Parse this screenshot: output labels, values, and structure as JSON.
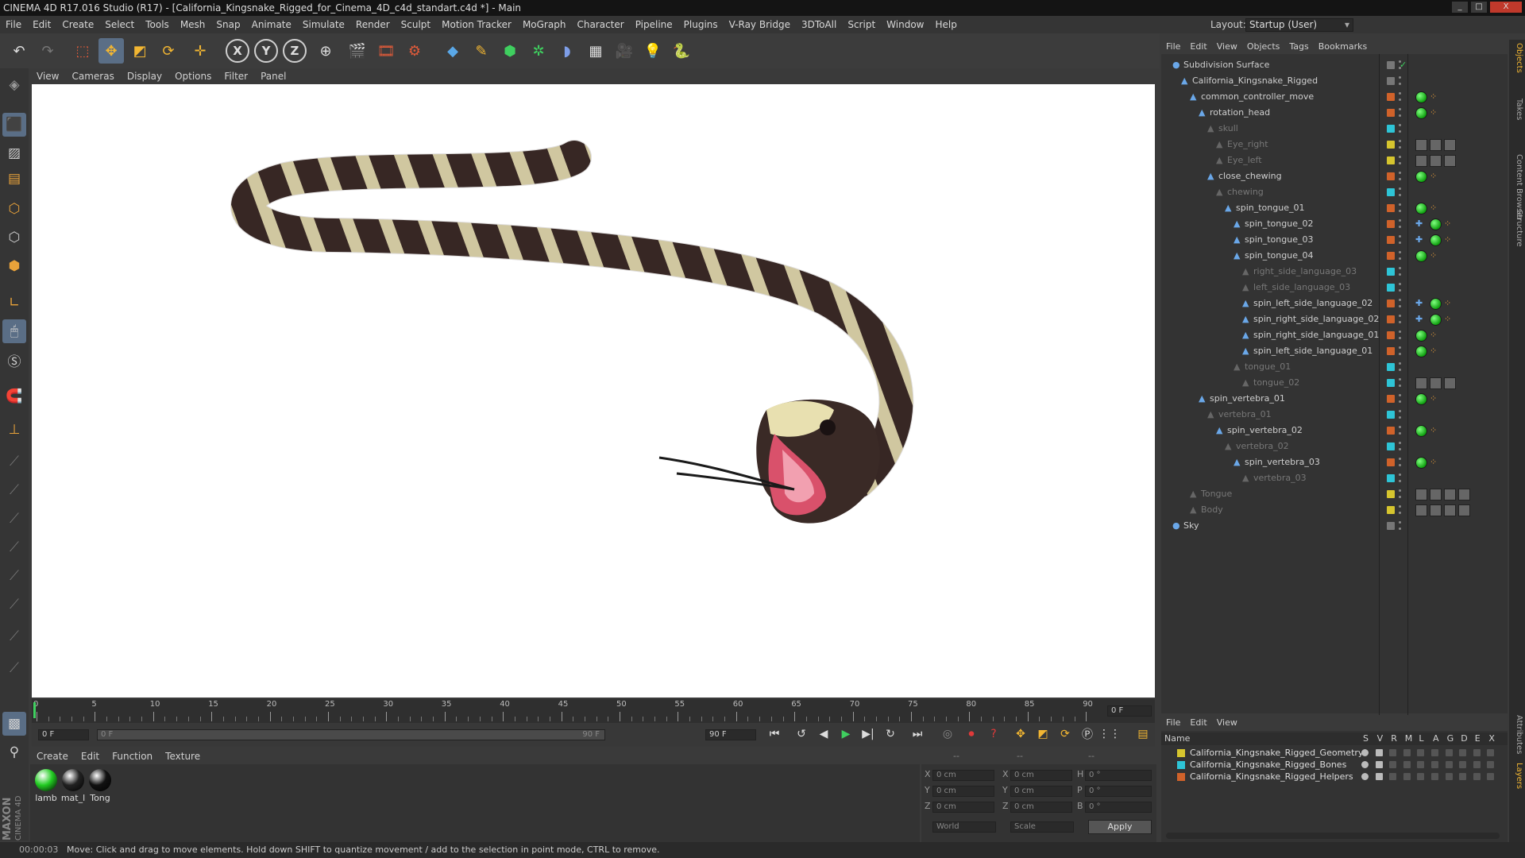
{
  "window": {
    "title": "CINEMA 4D R17.016 Studio (R17) - [California_Kingsnake_Rigged_for_Cinema_4D_c4d_standart.c4d *] - Main",
    "controls": [
      "_",
      "□",
      "X"
    ]
  },
  "menu": [
    "File",
    "Edit",
    "Create",
    "Select",
    "Tools",
    "Mesh",
    "Snap",
    "Animate",
    "Simulate",
    "Render",
    "Sculpt",
    "Motion Tracker",
    "MoGraph",
    "Character",
    "Pipeline",
    "Plugins",
    "V-Ray Bridge",
    "3DToAll",
    "Script",
    "Window",
    "Help"
  ],
  "layout": {
    "label": "Layout:",
    "value": "Startup (User)"
  },
  "toolbar": {
    "axis_x": "X",
    "axis_y": "Y",
    "axis_z": "Z"
  },
  "viewport_menu": [
    "View",
    "Cameras",
    "Display",
    "Options",
    "Filter",
    "Panel"
  ],
  "timeline": {
    "ticks": [
      "0",
      "5",
      "10",
      "15",
      "20",
      "25",
      "30",
      "35",
      "40",
      "45",
      "50",
      "55",
      "60",
      "65",
      "70",
      "75",
      "80",
      "85",
      "90"
    ],
    "frame_right": "0 F"
  },
  "timectrl": {
    "start": "0 F",
    "range_left": "0 F",
    "range_right": "90 F",
    "end": "90 F"
  },
  "material_menu": [
    "Create",
    "Edit",
    "Function",
    "Texture"
  ],
  "materials": [
    {
      "label": "lamb",
      "color": "#22cc22"
    },
    {
      "label": "mat_l",
      "color": "#222222"
    },
    {
      "label": "Tong",
      "color": "#111111"
    }
  ],
  "coords": {
    "rows": [
      {
        "a": "X",
        "av": "0 cm",
        "b": "X",
        "bv": "0 cm",
        "c": "H",
        "cv": "0 °"
      },
      {
        "a": "Y",
        "av": "0 cm",
        "b": "Y",
        "bv": "0 cm",
        "c": "P",
        "cv": "0 °"
      },
      {
        "a": "Z",
        "av": "0 cm",
        "b": "Z",
        "bv": "0 cm",
        "c": "B",
        "cv": "0 °"
      }
    ],
    "world": "World",
    "scale": "Scale",
    "apply": "Apply",
    "headers": [
      "--",
      "--",
      "--"
    ]
  },
  "status": {
    "time": "00:00:03",
    "text": "Move: Click and drag to move elements. Hold down SHIFT to quantize movement / add to the selection in point mode, CTRL to remove."
  },
  "object_menu": [
    "File",
    "Edit",
    "View",
    "Objects",
    "Tags",
    "Bookmarks"
  ],
  "objects": [
    {
      "name": "Subdivision Surface",
      "indent": 0,
      "dim": false,
      "vis": "#777777",
      "tags": 0
    },
    {
      "name": "California_Kingsnake_Rigged",
      "indent": 1,
      "dim": false,
      "vis": "#777777",
      "tags": 0
    },
    {
      "name": "common_controller_move",
      "indent": 2,
      "dim": false,
      "vis": "#d0622a",
      "tags": 1
    },
    {
      "name": "rotation_head",
      "indent": 3,
      "dim": false,
      "vis": "#d0622a",
      "tags": 1
    },
    {
      "name": "skull",
      "indent": 4,
      "dim": true,
      "vis": "#2ec4d6",
      "tags": 0
    },
    {
      "name": "Eye_right",
      "indent": 5,
      "dim": true,
      "vis": "#d6c52e",
      "tags": 2
    },
    {
      "name": "Eye_left",
      "indent": 5,
      "dim": true,
      "vis": "#d6c52e",
      "tags": 2
    },
    {
      "name": "close_chewing",
      "indent": 4,
      "dim": false,
      "vis": "#d0622a",
      "tags": 1
    },
    {
      "name": "chewing",
      "indent": 5,
      "dim": true,
      "vis": "#2ec4d6",
      "tags": 0
    },
    {
      "name": "spin_tongue_01",
      "indent": 6,
      "dim": false,
      "vis": "#d0622a",
      "tags": 1
    },
    {
      "name": "spin_tongue_02",
      "indent": 7,
      "dim": false,
      "vis": "#d0622a",
      "tags": 3
    },
    {
      "name": "spin_tongue_03",
      "indent": 7,
      "dim": false,
      "vis": "#d0622a",
      "tags": 3
    },
    {
      "name": "spin_tongue_04",
      "indent": 7,
      "dim": false,
      "vis": "#d0622a",
      "tags": 1
    },
    {
      "name": "right_side_language_03",
      "indent": 8,
      "dim": true,
      "vis": "#2ec4d6",
      "tags": 0
    },
    {
      "name": "left_side_language_03",
      "indent": 8,
      "dim": true,
      "vis": "#2ec4d6",
      "tags": 0
    },
    {
      "name": "spin_left_side_language_02",
      "indent": 8,
      "dim": false,
      "vis": "#d0622a",
      "tags": 3
    },
    {
      "name": "spin_right_side_language_02",
      "indent": 8,
      "dim": false,
      "vis": "#d0622a",
      "tags": 3
    },
    {
      "name": "spin_right_side_language_01",
      "indent": 8,
      "dim": false,
      "vis": "#d0622a",
      "tags": 1
    },
    {
      "name": "spin_left_side_language_01",
      "indent": 8,
      "dim": false,
      "vis": "#d0622a",
      "tags": 1
    },
    {
      "name": "tongue_01",
      "indent": 7,
      "dim": true,
      "vis": "#2ec4d6",
      "tags": 0
    },
    {
      "name": "tongue_02",
      "indent": 8,
      "dim": true,
      "vis": "#2ec4d6",
      "tags": 2
    },
    {
      "name": "spin_vertebra_01",
      "indent": 3,
      "dim": false,
      "vis": "#d0622a",
      "tags": 1
    },
    {
      "name": "vertebra_01",
      "indent": 4,
      "dim": true,
      "vis": "#2ec4d6",
      "tags": 0
    },
    {
      "name": "spin_vertebra_02",
      "indent": 5,
      "dim": false,
      "vis": "#d0622a",
      "tags": 1
    },
    {
      "name": "vertebra_02",
      "indent": 6,
      "dim": true,
      "vis": "#2ec4d6",
      "tags": 0
    },
    {
      "name": "spin_vertebra_03",
      "indent": 7,
      "dim": false,
      "vis": "#d0622a",
      "tags": 1
    },
    {
      "name": "vertebra_03",
      "indent": 8,
      "dim": true,
      "vis": "#2ec4d6",
      "tags": 0
    },
    {
      "name": "Tongue",
      "indent": 2,
      "dim": true,
      "vis": "#d6c52e",
      "tags": 4
    },
    {
      "name": "Body",
      "indent": 2,
      "dim": true,
      "vis": "#d6c52e",
      "tags": 4
    },
    {
      "name": "Sky",
      "indent": 0,
      "dim": false,
      "vis": "#777777",
      "tags": 0
    }
  ],
  "layer_menu": [
    "File",
    "Edit",
    "View"
  ],
  "layer_header": {
    "name": "Name",
    "cols": [
      "S",
      "V",
      "R",
      "M",
      "L",
      "A",
      "G",
      "D",
      "E",
      "X"
    ]
  },
  "layers": [
    {
      "name": "California_Kingsnake_Rigged_Geometry",
      "color": "#d6c52e"
    },
    {
      "name": "California_Kingsnake_Rigged_Bones",
      "color": "#2ec4d6"
    },
    {
      "name": "California_Kingsnake_Rigged_Helpers",
      "color": "#d0622a"
    }
  ],
  "right_tabs": [
    "Objects",
    "Takes",
    "Content Browser",
    "Structure"
  ],
  "right_tabs_bottom": [
    "Attributes",
    "Layers"
  ],
  "brand": {
    "line1": "MAXON",
    "line2": "CINEMA 4D"
  }
}
